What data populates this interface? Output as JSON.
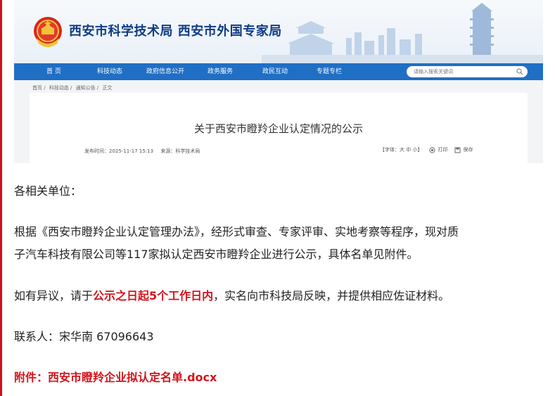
{
  "site": {
    "title": "西安市科学技术局  西安市外国专家局"
  },
  "nav": {
    "items": [
      {
        "label": "首  页"
      },
      {
        "label": "科技动态"
      },
      {
        "label": "政府信息公开"
      },
      {
        "label": "政务服务"
      },
      {
        "label": "政民互动"
      },
      {
        "label": "专题专栏"
      }
    ],
    "search_placeholder": "请输入搜索关键词"
  },
  "breadcrumb": {
    "items": [
      "首页 /",
      "科技动态 /",
      "通知公告 /",
      "正文"
    ]
  },
  "article": {
    "title": "关于西安市瞪羚企业认定情况的公示",
    "publish_time": "发布时间：2025-11-17 15:13",
    "source": "来源：科学技术局",
    "font_size": "【字体：大 中 小】",
    "print": "打印",
    "save": "保存"
  },
  "content": {
    "salutation": "各相关单位：",
    "para1_line1": "根据《西安市瞪羚企业认定管理办法》，经形式审查、专家评审、实地考察等程序，现对质",
    "para1_line2": "子汽车科技有限公司等117家拟认定西安市瞪羚企业进行公示，具体名单见附件。",
    "para2_prefix": "如有异议，请于",
    "para2_highlight": "公示之日起5个工作日内",
    "para2_suffix": "，实名向市科技局反映，并提供相应佐证材料。",
    "contact": "联系人：宋华南 67096643",
    "attachment": "附件：西安市瞪羚企业拟认定名单.docx"
  },
  "colors": {
    "accent_red": "#d2141b",
    "nav_blue": "#1f6fc5",
    "title_blue": "#0e3b86"
  }
}
